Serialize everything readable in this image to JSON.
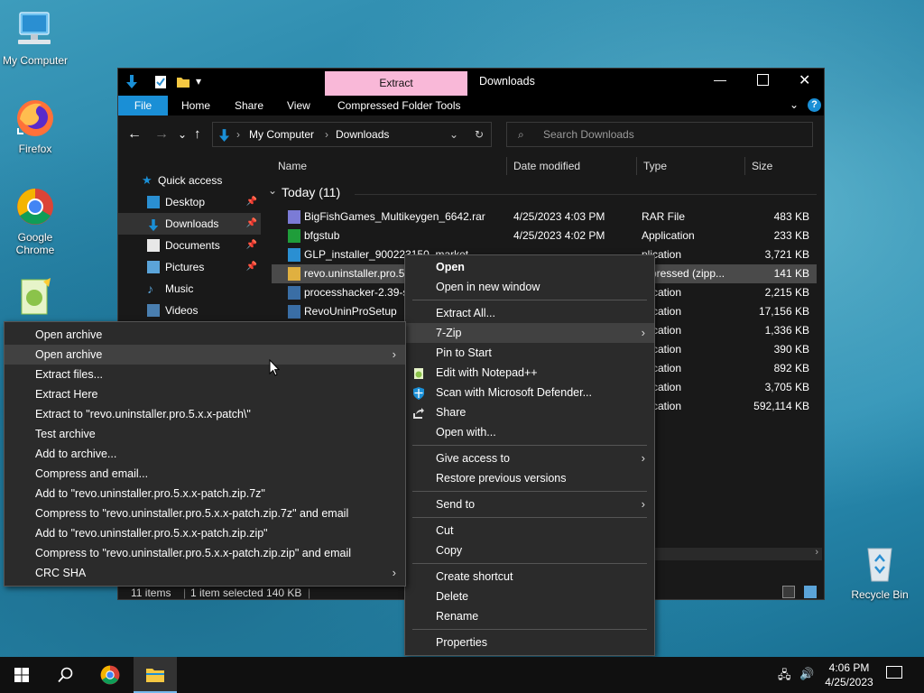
{
  "desktop": {
    "icons": [
      {
        "label": "My Computer"
      },
      {
        "label": "Firefox"
      },
      {
        "label": "Google Chrome"
      },
      {
        "label": "Recycle Bin"
      }
    ]
  },
  "explorer": {
    "title": "Downloads",
    "contextual_tab": "Extract",
    "tabs": [
      "File",
      "Home",
      "Share",
      "View",
      "Compressed Folder Tools"
    ],
    "address": [
      "My Computer",
      "Downloads"
    ],
    "search_placeholder": "Search Downloads",
    "nav": [
      {
        "label": "Quick access"
      },
      {
        "label": "Desktop",
        "pinned": true
      },
      {
        "label": "Downloads",
        "pinned": true
      },
      {
        "label": "Documents",
        "pinned": true
      },
      {
        "label": "Pictures",
        "pinned": true
      },
      {
        "label": "Music"
      },
      {
        "label": "Videos"
      }
    ],
    "columns": [
      "Name",
      "Date modified",
      "Type",
      "Size"
    ],
    "group": "Today (11)",
    "files": [
      {
        "name": "BigFishGames_Multikeygen_6642.rar",
        "date": "4/25/2023 4:03 PM",
        "type": "RAR File",
        "size": "483 KB"
      },
      {
        "name": "bfgstub",
        "date": "4/25/2023 4:02 PM",
        "type": "Application",
        "size": "233 KB"
      },
      {
        "name": "GLP_installer_900223150_market",
        "date": "",
        "type": "plication",
        "size": "3,721 KB"
      },
      {
        "name": "revo.uninstaller.pro.5.x",
        "date": "",
        "type": "mpressed (zipp...",
        "size": "141 KB"
      },
      {
        "name": "processhacker-2.39-set",
        "date": "",
        "type": "plication",
        "size": "2,215 KB"
      },
      {
        "name": "RevoUninProSetup",
        "date": "",
        "type": "plication",
        "size": "17,156 KB"
      },
      {
        "name": "",
        "date": "",
        "type": "plication",
        "size": "1,336 KB"
      },
      {
        "name": "",
        "date": "",
        "type": "plication",
        "size": "390 KB"
      },
      {
        "name": "",
        "date": "",
        "type": "plication",
        "size": "892 KB"
      },
      {
        "name": "",
        "date": "",
        "type": "plication",
        "size": "3,705 KB"
      },
      {
        "name": "",
        "date": "",
        "type": "plication",
        "size": "592,114 KB"
      }
    ],
    "status": {
      "count": "11 items",
      "selected": "1 item selected  140 KB"
    }
  },
  "context_menu": {
    "items": [
      {
        "label": "Open",
        "bold": true
      },
      {
        "label": "Open in new window"
      },
      {
        "label": "Extract All..."
      },
      {
        "label": "7-Zip",
        "submenu": true
      },
      {
        "label": "Pin to Start"
      },
      {
        "label": "Edit with Notepad++"
      },
      {
        "label": "Scan with Microsoft Defender..."
      },
      {
        "label": "Share"
      },
      {
        "label": "Open with..."
      },
      {
        "label": "Give access to",
        "submenu": true
      },
      {
        "label": "Restore previous versions"
      },
      {
        "label": "Send to",
        "submenu": true
      },
      {
        "label": "Cut"
      },
      {
        "label": "Copy"
      },
      {
        "label": "Create shortcut"
      },
      {
        "label": "Delete"
      },
      {
        "label": "Rename"
      },
      {
        "label": "Properties"
      }
    ]
  },
  "zip_menu": {
    "items": [
      {
        "label": "Open archive"
      },
      {
        "label": "Open archive",
        "submenu": true
      },
      {
        "label": "Extract files..."
      },
      {
        "label": "Extract Here"
      },
      {
        "label": "Extract to \"revo.uninstaller.pro.5.x.x-patch\\\""
      },
      {
        "label": "Test archive"
      },
      {
        "label": "Add to archive..."
      },
      {
        "label": "Compress and email..."
      },
      {
        "label": "Add to \"revo.uninstaller.pro.5.x.x-patch.zip.7z\""
      },
      {
        "label": "Compress to \"revo.uninstaller.pro.5.x.x-patch.zip.7z\" and email"
      },
      {
        "label": "Add to \"revo.uninstaller.pro.5.x.x-patch.zip.zip\""
      },
      {
        "label": "Compress to \"revo.uninstaller.pro.5.x.x-patch.zip.zip\" and email"
      },
      {
        "label": "CRC SHA",
        "submenu": true
      }
    ]
  },
  "taskbar": {
    "time": "4:06 PM",
    "date": "4/25/2023"
  },
  "colors": {
    "contextual_tab": "#f9b8d8",
    "ribbon_file": "#1a8fd6",
    "accent": "#1a8fd6"
  }
}
